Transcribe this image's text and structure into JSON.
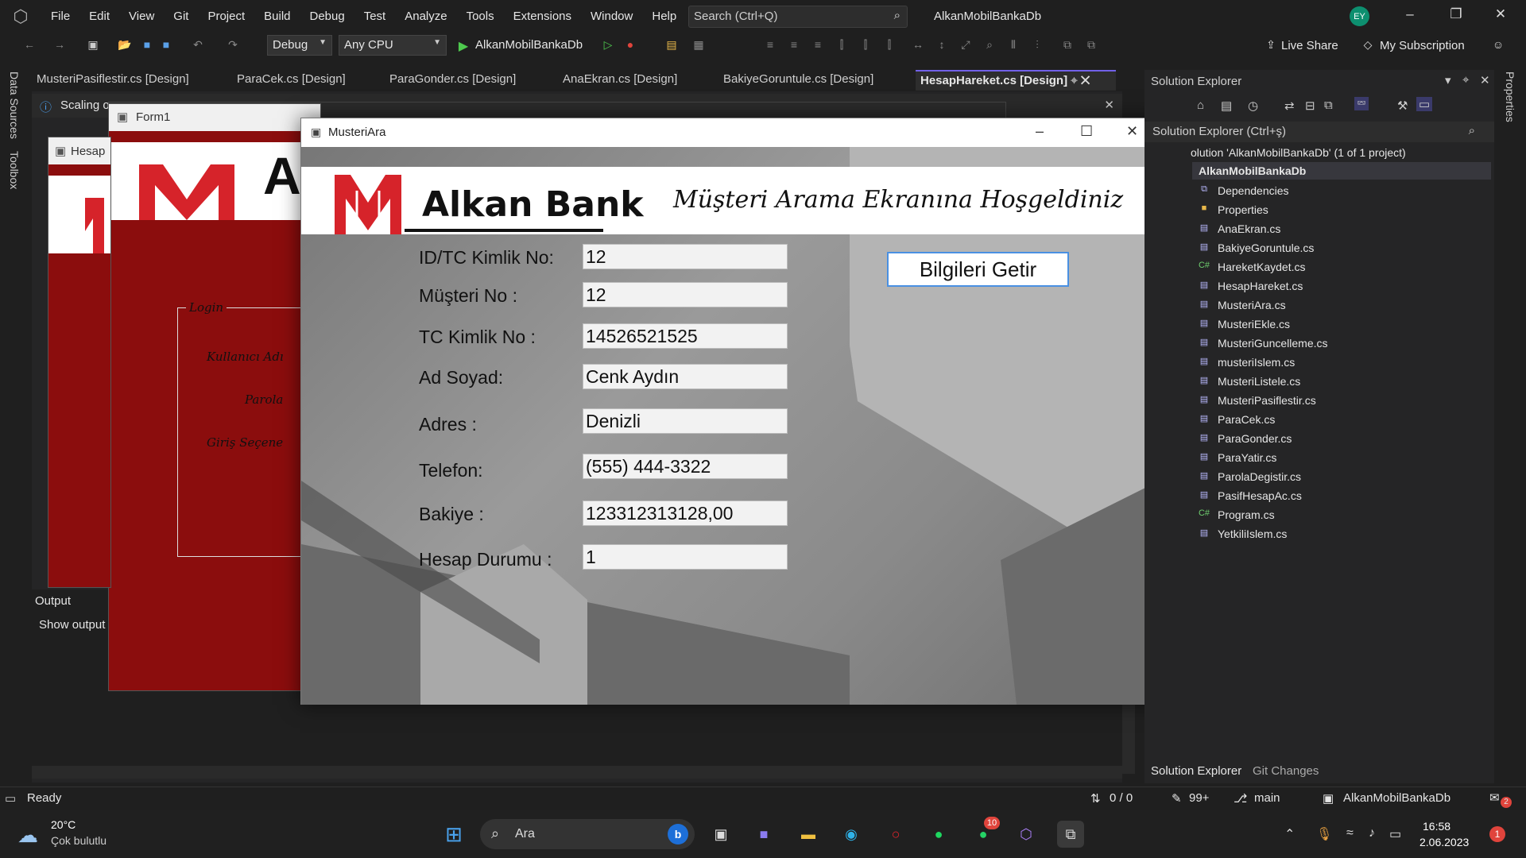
{
  "menu": [
    "File",
    "Edit",
    "View",
    "Git",
    "Project",
    "Build",
    "Debug",
    "Test",
    "Analyze",
    "Tools",
    "Extensions",
    "Window",
    "Help"
  ],
  "search": {
    "placeholder": "Search (Ctrl+Q)"
  },
  "solution_title": "AlkanMobilBankaDb",
  "avatar": "EY",
  "toolbar": {
    "config": "Debug",
    "platform": "Any CPU",
    "run_target": "AlkanMobilBankaDb",
    "live_share": "Live Share",
    "subscription": "My Subscription"
  },
  "left_strip": {
    "data_sources": "Data Sources",
    "toolbox": "Toolbox"
  },
  "right_strip": {
    "properties": "Properties"
  },
  "tabs": [
    "MusteriPasiflestir.cs [Design]",
    "ParaCek.cs [Design]",
    "ParaGonder.cs [Design]",
    "AnaEkran.cs [Design]",
    "BakiyeGoruntule.cs [Design]",
    "HesapHareket.cs [Design]"
  ],
  "infobar": "Scaling o",
  "output": {
    "title": "Output",
    "show_output": "Show output"
  },
  "solution_explorer": {
    "header": "Solution Explorer",
    "search": "Solution Explorer (Ctrl+ş)",
    "solution_line": "olution 'AlkanMobilBankaDb' (1 of 1 project)",
    "project": "AlkanMobilBankaDb",
    "items": [
      "Dependencies",
      "Properties",
      "AnaEkran.cs",
      "BakiyeGoruntule.cs",
      "HareketKaydet.cs",
      "HesapHareket.cs",
      "MusteriAra.cs",
      "MusteriEkle.cs",
      "MusteriGuncelleme.cs",
      "musteriIslem.cs",
      "MusteriListele.cs",
      "MusteriPasiflestir.cs",
      "ParaCek.cs",
      "ParaGonder.cs",
      "ParaYatir.cs",
      "ParolaDegistir.cs",
      "PasifHesapAc.cs",
      "Program.cs",
      "YetkiliIslem.cs"
    ],
    "tabs": [
      "Solution Explorer",
      "Git Changes"
    ]
  },
  "forms": {
    "form1_title": "Form1",
    "hesap_title": "Hesap",
    "form1_login": "Login",
    "form1_labels": [
      "Kullanıcı Adı",
      "Parola",
      "Giriş Seçene"
    ],
    "form1_logo_letter": "A"
  },
  "musteri_ara": {
    "title": "MusteriAra",
    "bank_name": "Alkan Bank",
    "welcome": "Müşteri Arama Ekranına Hoşgeldiniz",
    "button": "Bilgileri Getir",
    "fields": [
      {
        "label": "ID/TC Kimlik No:",
        "value": "12"
      },
      {
        "label": "Müşteri No :",
        "value": "12"
      },
      {
        "label": "TC Kimlik No :",
        "value": "14526521525"
      },
      {
        "label": "Ad Soyad:",
        "value": "Cenk Aydın"
      },
      {
        "label": "Adres :",
        "value": "Denizli"
      },
      {
        "label": "Telefon:",
        "value": "(555) 444-3322"
      },
      {
        "label": "Bakiye :",
        "value": "123312313128,00"
      },
      {
        "label": "Hesap Durumu :",
        "value": "1"
      }
    ]
  },
  "status": {
    "ready": "Ready",
    "lines": "0 / 0",
    "edits": "99+",
    "branch": "main",
    "repo": "AlkanMobilBankaDb",
    "notif": "2"
  },
  "taskbar": {
    "temp": "20°C",
    "weather": "Çok bulutlu",
    "search": "Ara",
    "time": "16:58",
    "date": "2.06.2023",
    "whatsapp_badge": "10",
    "tray_badge": "1"
  }
}
